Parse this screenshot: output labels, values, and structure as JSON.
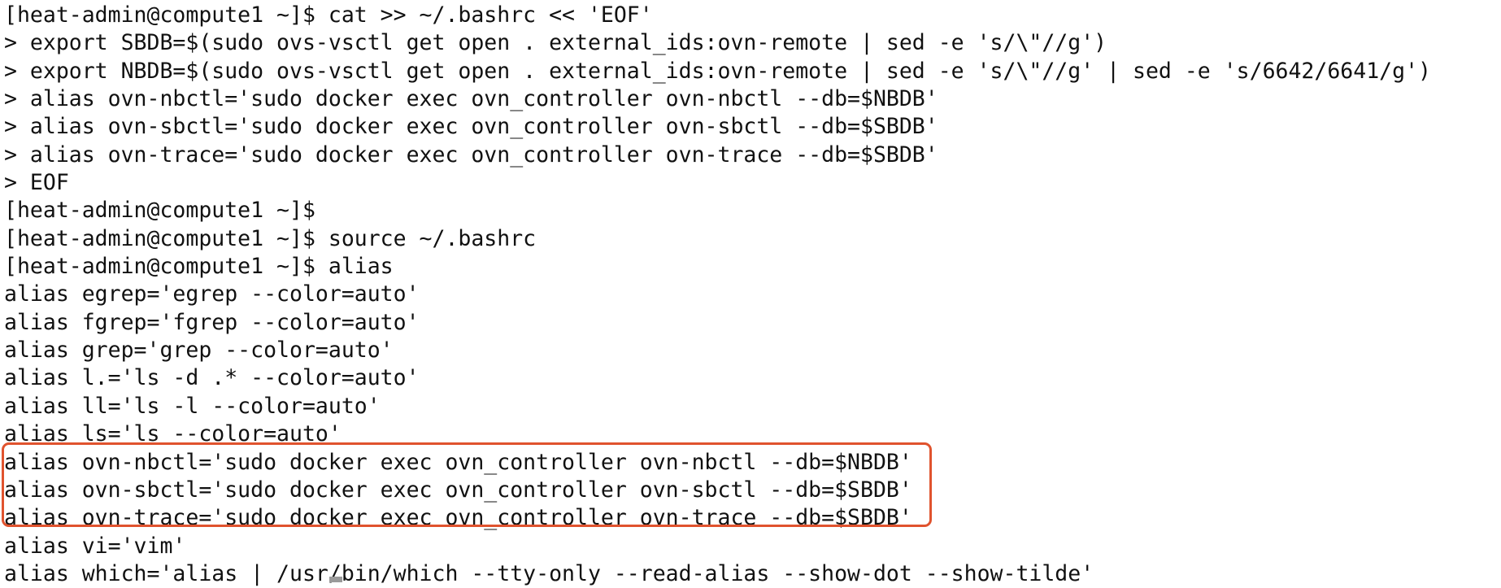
{
  "terminal": {
    "lines": [
      "[heat-admin@compute1 ~]$ cat >> ~/.bashrc << 'EOF'",
      "> export SBDB=$(sudo ovs-vsctl get open . external_ids:ovn-remote | sed -e 's/\\\"//g')",
      "> export NBDB=$(sudo ovs-vsctl get open . external_ids:ovn-remote | sed -e 's/\\\"//g' | sed -e 's/6642/6641/g')",
      "> alias ovn-nbctl='sudo docker exec ovn_controller ovn-nbctl --db=$NBDB'",
      "> alias ovn-sbctl='sudo docker exec ovn_controller ovn-sbctl --db=$SBDB'",
      "> alias ovn-trace='sudo docker exec ovn_controller ovn-trace --db=$SBDB'",
      "> EOF",
      "[heat-admin@compute1 ~]$",
      "[heat-admin@compute1 ~]$ source ~/.bashrc",
      "[heat-admin@compute1 ~]$ alias",
      "alias egrep='egrep --color=auto'",
      "alias fgrep='fgrep --color=auto'",
      "alias grep='grep --color=auto'",
      "alias l.='ls -d .* --color=auto'",
      "alias ll='ls -l --color=auto'",
      "alias ls='ls --color=auto'",
      "alias ovn-nbctl='sudo docker exec ovn_controller ovn-nbctl --db=$NBDB'",
      "alias ovn-sbctl='sudo docker exec ovn_controller ovn-sbctl --db=$SBDB'",
      "alias ovn-trace='sudo docker exec ovn_controller ovn-trace --db=$SBDB'",
      "alias vi='vim'",
      "alias which='alias | /usr/bin/which --tty-only --read-alias --show-dot --show-tilde'"
    ]
  },
  "colors": {
    "background": "#ffffff",
    "text": "#111111",
    "highlight_border": "#e0532e",
    "cursor": "#9a9a9a"
  }
}
